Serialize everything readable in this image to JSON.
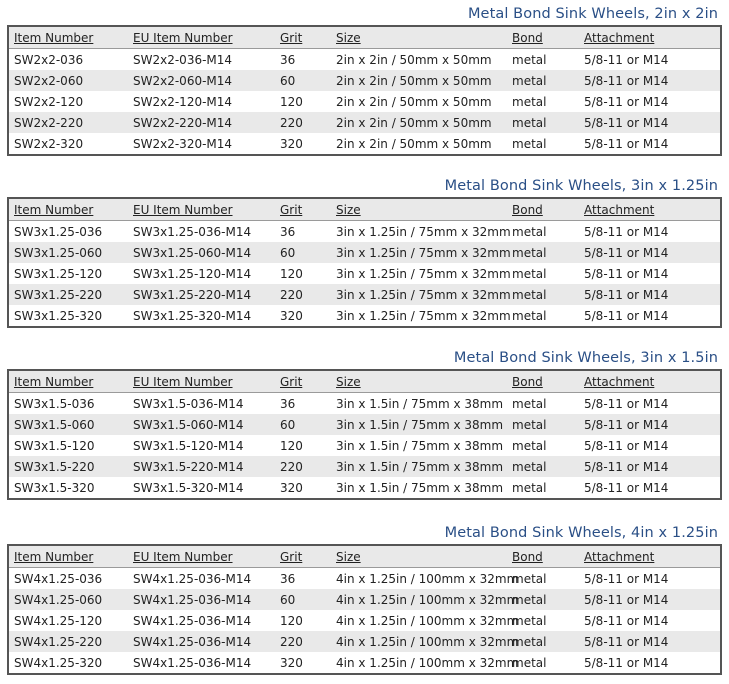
{
  "columns": [
    "Item Number",
    "EU Item Number",
    "Grit",
    "Size",
    "Bond",
    "Attachment"
  ],
  "sections": [
    {
      "title": "Metal Bond Sink Wheels, 2in x 2in",
      "rows": [
        [
          "SW2x2-036",
          "SW2x2-036-M14",
          "36",
          "2in x 2in / 50mm x 50mm",
          "metal",
          "5/8-11 or M14"
        ],
        [
          "SW2x2-060",
          "SW2x2-060-M14",
          "60",
          "2in x 2in / 50mm x 50mm",
          "metal",
          "5/8-11 or M14"
        ],
        [
          "SW2x2-120",
          "SW2x2-120-M14",
          "120",
          "2in x 2in / 50mm x 50mm",
          "metal",
          "5/8-11 or M14"
        ],
        [
          "SW2x2-220",
          "SW2x2-220-M14",
          "220",
          "2in x 2in / 50mm x 50mm",
          "metal",
          "5/8-11 or M14"
        ],
        [
          "SW2x2-320",
          "SW2x2-320-M14",
          "320",
          "2in x 2in / 50mm x 50mm",
          "metal",
          "5/8-11 or M14"
        ]
      ]
    },
    {
      "title": "Metal Bond Sink Wheels, 3in x 1.25in",
      "rows": [
        [
          "SW3x1.25-036",
          "SW3x1.25-036-M14",
          "36",
          "3in x 1.25in / 75mm x 32mm",
          "metal",
          "5/8-11 or M14"
        ],
        [
          "SW3x1.25-060",
          "SW3x1.25-060-M14",
          "60",
          "3in x 1.25in / 75mm x 32mm",
          "metal",
          "5/8-11 or M14"
        ],
        [
          "SW3x1.25-120",
          "SW3x1.25-120-M14",
          "120",
          "3in x 1.25in / 75mm x 32mm",
          "metal",
          "5/8-11 or M14"
        ],
        [
          "SW3x1.25-220",
          "SW3x1.25-220-M14",
          "220",
          "3in x 1.25in / 75mm x 32mm",
          "metal",
          "5/8-11 or M14"
        ],
        [
          "SW3x1.25-320",
          "SW3x1.25-320-M14",
          "320",
          "3in x 1.25in / 75mm x 32mm",
          "metal",
          "5/8-11 or M14"
        ]
      ]
    },
    {
      "title": "Metal Bond Sink Wheels, 3in x 1.5in",
      "rows": [
        [
          "SW3x1.5-036",
          "SW3x1.5-036-M14",
          "36",
          "3in x 1.5in / 75mm x 38mm",
          "metal",
          "5/8-11 or M14"
        ],
        [
          "SW3x1.5-060",
          "SW3x1.5-060-M14",
          "60",
          "3in x 1.5in / 75mm x 38mm",
          "metal",
          "5/8-11 or M14"
        ],
        [
          "SW3x1.5-120",
          "SW3x1.5-120-M14",
          "120",
          "3in x 1.5in / 75mm x 38mm",
          "metal",
          "5/8-11 or M14"
        ],
        [
          "SW3x1.5-220",
          "SW3x1.5-220-M14",
          "220",
          "3in x 1.5in / 75mm x 38mm",
          "metal",
          "5/8-11 or M14"
        ],
        [
          "SW3x1.5-320",
          "SW3x1.5-320-M14",
          "320",
          "3in x 1.5in / 75mm x 38mm",
          "metal",
          "5/8-11 or M14"
        ]
      ]
    },
    {
      "title": "Metal Bond Sink Wheels, 4in x 1.25in",
      "rows": [
        [
          "SW4x1.25-036",
          "SW4x1.25-036-M14",
          "36",
          "4in x 1.25in / 100mm x 32mm",
          "metal",
          "5/8-11 or M14"
        ],
        [
          "SW4x1.25-060",
          "SW4x1.25-036-M14",
          "60",
          "4in x 1.25in / 100mm x 32mm",
          "metal",
          "5/8-11 or M14"
        ],
        [
          "SW4x1.25-120",
          "SW4x1.25-036-M14",
          "120",
          "4in x 1.25in / 100mm x 32mm",
          "metal",
          "5/8-11 or M14"
        ],
        [
          "SW4x1.25-220",
          "SW4x1.25-036-M14",
          "220",
          "4in x 1.25in / 100mm x 32mm",
          "metal",
          "5/8-11 or M14"
        ],
        [
          "SW4x1.25-320",
          "SW4x1.25-036-M14",
          "320",
          "4in x 1.25in / 100mm x 32mm",
          "metal",
          "5/8-11 or M14"
        ]
      ]
    }
  ]
}
